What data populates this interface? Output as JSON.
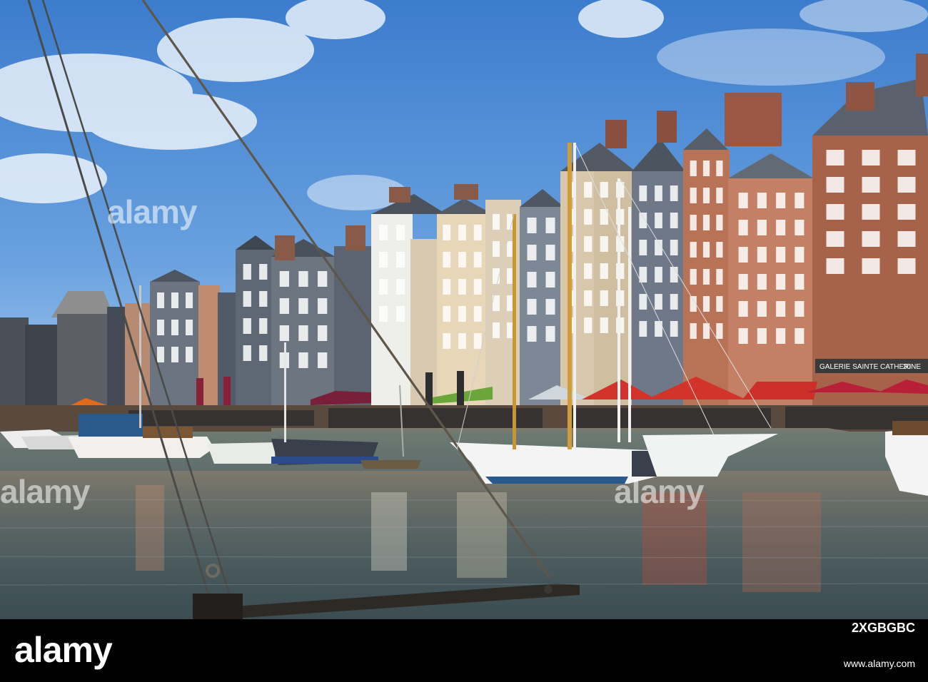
{
  "photo": {
    "subject": "Honfleur harbour (Vieux Bassin) with tall slate and brick townhouses and moored sailing boats",
    "shop_sign": "GALERIE SAINTE CATHERINE",
    "house_number": "30"
  },
  "watermark": {
    "text": "alamy"
  },
  "footer": {
    "logo": "alamy",
    "image_id": "2XGBGBC",
    "url": "www.alamy.com",
    "background": "#000000"
  },
  "colors": {
    "sky_top": "#3f7fcf",
    "sky_bottom": "#a9cbee",
    "water": "#4f6466",
    "awning_red": "#d2332a",
    "slate": "#5b6470",
    "brick": "#b06a52"
  }
}
